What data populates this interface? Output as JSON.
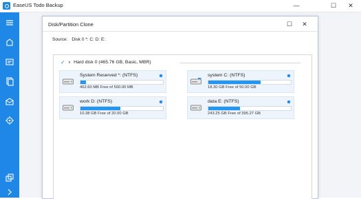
{
  "app": {
    "title": "EaseUS Todo Backup",
    "brand_color": "#1f87e5"
  },
  "window_controls": {
    "minimize": "—",
    "maximize": "☐",
    "close": "✕"
  },
  "sidebar": {
    "icons": [
      "menu-icon",
      "backup-icon",
      "clone-icon",
      "files-icon",
      "mail-icon",
      "tools-icon",
      "restore-icon",
      "expand-icon"
    ]
  },
  "dialog": {
    "title": "Disk/Partition Clone",
    "maximize": "☐",
    "close": "✕",
    "source_label": "Source:",
    "source_value": "Disk 0 *: C: D: E:",
    "disk": {
      "checkbox": "✓",
      "chevron": "∨",
      "label": "Hard disk 0 (465.76 GB, Basic, MBR)"
    },
    "partitions": [
      {
        "name": "System Reserved *: (NTFS)",
        "free": "462.60 MB Free of 500.00 MB",
        "used_fraction": 0.07,
        "icon": "drive-icon"
      },
      {
        "name": "system C: (NTFS)",
        "free": "18.30 GB Free of 50.00 GB",
        "used_fraction": 0.63,
        "icon": "windows-drive-icon"
      },
      {
        "name": "work D: (NTFS)",
        "free": "10.38 GB Free of 20.00 GB",
        "used_fraction": 0.48,
        "icon": "drive-icon"
      },
      {
        "name": "data E: (NTFS)",
        "free": "243.25 GB Free of 395.27 GB",
        "used_fraction": 0.38,
        "icon": "drive-icon"
      }
    ]
  }
}
